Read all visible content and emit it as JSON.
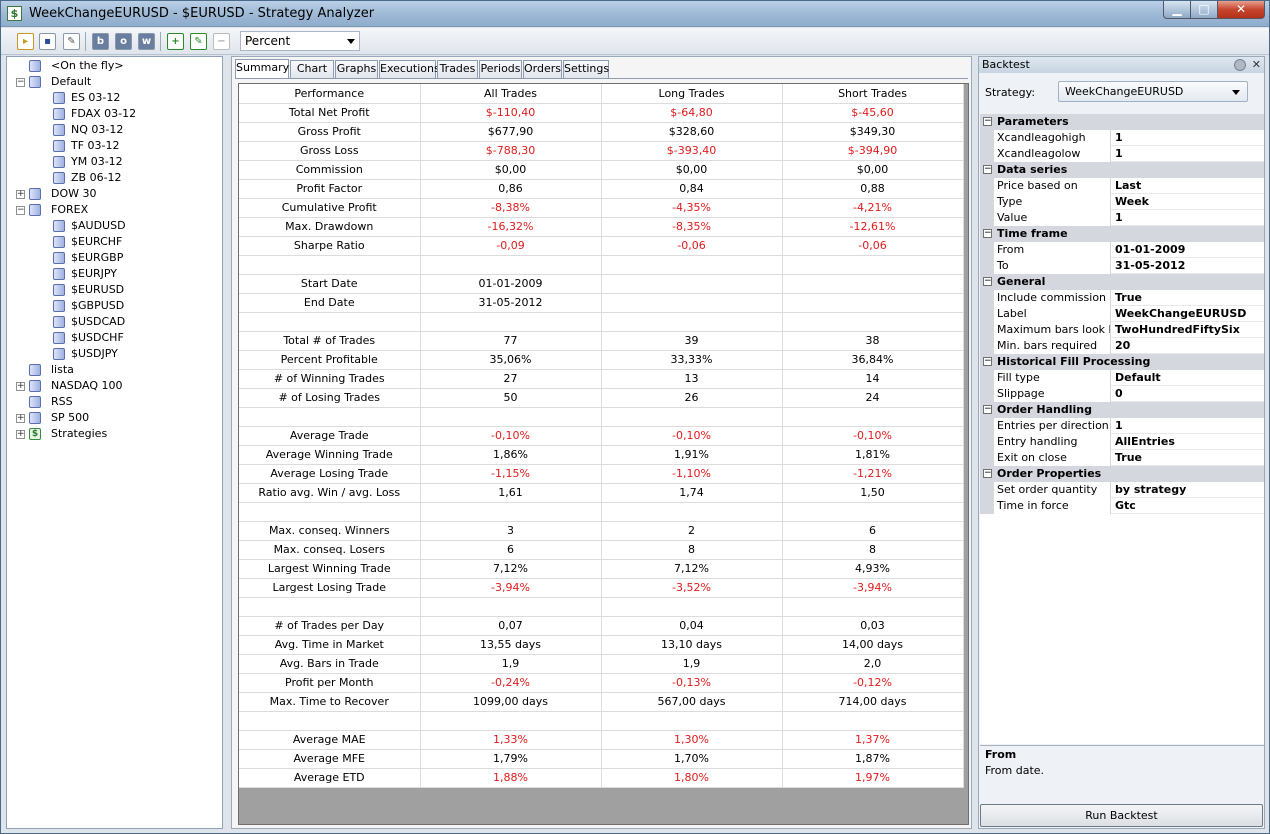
{
  "window": {
    "title": "WeekChangeEURUSD - $EURUSD - Strategy Analyzer"
  },
  "toolbar": {
    "buttons": [
      "open-icon",
      "save-icon",
      "edit-icon",
      "b-icon",
      "o-icon",
      "w-icon",
      "add-icon",
      "edit-strategy-icon",
      "remove-icon"
    ],
    "display_unit": "Percent"
  },
  "tree": {
    "items": [
      {
        "label": "<On the fly>",
        "level": 1,
        "expander": "",
        "icon": "db"
      },
      {
        "label": "Default",
        "level": 0,
        "expander": "−",
        "icon": "db"
      },
      {
        "label": "ES 03-12",
        "level": 2,
        "expander": "",
        "icon": "db"
      },
      {
        "label": "FDAX 03-12",
        "level": 2,
        "expander": "",
        "icon": "db"
      },
      {
        "label": "NQ 03-12",
        "level": 2,
        "expander": "",
        "icon": "db"
      },
      {
        "label": "TF 03-12",
        "level": 2,
        "expander": "",
        "icon": "db"
      },
      {
        "label": "YM 03-12",
        "level": 2,
        "expander": "",
        "icon": "db"
      },
      {
        "label": "ZB 06-12",
        "level": 2,
        "expander": "",
        "icon": "db"
      },
      {
        "label": "DOW 30",
        "level": 0,
        "expander": "+",
        "icon": "db"
      },
      {
        "label": "FOREX",
        "level": 0,
        "expander": "−",
        "icon": "db"
      },
      {
        "label": "$AUDUSD",
        "level": 2,
        "expander": "",
        "icon": "db"
      },
      {
        "label": "$EURCHF",
        "level": 2,
        "expander": "",
        "icon": "db"
      },
      {
        "label": "$EURGBP",
        "level": 2,
        "expander": "",
        "icon": "db"
      },
      {
        "label": "$EURJPY",
        "level": 2,
        "expander": "",
        "icon": "db"
      },
      {
        "label": "$EURUSD",
        "level": 2,
        "expander": "",
        "icon": "db"
      },
      {
        "label": "$GBPUSD",
        "level": 2,
        "expander": "",
        "icon": "db"
      },
      {
        "label": "$USDCAD",
        "level": 2,
        "expander": "",
        "icon": "db"
      },
      {
        "label": "$USDCHF",
        "level": 2,
        "expander": "",
        "icon": "db"
      },
      {
        "label": "$USDJPY",
        "level": 2,
        "expander": "",
        "icon": "db"
      },
      {
        "label": "lista",
        "level": 1,
        "expander": "",
        "icon": "db"
      },
      {
        "label": "NASDAQ 100",
        "level": 0,
        "expander": "+",
        "icon": "db"
      },
      {
        "label": "RSS",
        "level": 1,
        "expander": "",
        "icon": "db"
      },
      {
        "label": "SP 500",
        "level": 0,
        "expander": "+",
        "icon": "db"
      },
      {
        "label": "Strategies",
        "level": 0,
        "expander": "+",
        "icon": "strategy"
      }
    ]
  },
  "tabs": [
    "Summary",
    "Chart",
    "Graphs",
    "Executions",
    "Trades",
    "Periods",
    "Orders",
    "Settings"
  ],
  "active_tab": "Summary",
  "summary": {
    "headers": [
      "Performance",
      "All Trades",
      "Long Trades",
      "Short Trades"
    ],
    "rows": [
      {
        "label": "Total Net Profit",
        "values": [
          "$-110,40",
          "$-64,80",
          "$-45,60"
        ],
        "negative": true
      },
      {
        "label": "Gross Profit",
        "values": [
          "$677,90",
          "$328,60",
          "$349,30"
        ],
        "negative": false
      },
      {
        "label": "Gross Loss",
        "values": [
          "$-788,30",
          "$-393,40",
          "$-394,90"
        ],
        "negative": true
      },
      {
        "label": "Commission",
        "values": [
          "$0,00",
          "$0,00",
          "$0,00"
        ],
        "negative": false
      },
      {
        "label": "Profit Factor",
        "values": [
          "0,86",
          "0,84",
          "0,88"
        ],
        "negative": false
      },
      {
        "label": "Cumulative Profit",
        "values": [
          "-8,38%",
          "-4,35%",
          "-4,21%"
        ],
        "negative": true
      },
      {
        "label": "Max. Drawdown",
        "values": [
          "-16,32%",
          "-8,35%",
          "-12,61%"
        ],
        "negative": true
      },
      {
        "label": "Sharpe Ratio",
        "values": [
          "-0,09",
          "-0,06",
          "-0,06"
        ],
        "negative": true
      },
      {
        "label": "",
        "values": [
          "",
          "",
          ""
        ],
        "negative": false
      },
      {
        "label": "Start Date",
        "values": [
          "01-01-2009",
          "",
          ""
        ],
        "negative": false
      },
      {
        "label": "End Date",
        "values": [
          "31-05-2012",
          "",
          ""
        ],
        "negative": false
      },
      {
        "label": "",
        "values": [
          "",
          "",
          ""
        ],
        "negative": false
      },
      {
        "label": "Total # of Trades",
        "values": [
          "77",
          "39",
          "38"
        ],
        "negative": false
      },
      {
        "label": "Percent Profitable",
        "values": [
          "35,06%",
          "33,33%",
          "36,84%"
        ],
        "negative": false
      },
      {
        "label": "# of Winning Trades",
        "values": [
          "27",
          "13",
          "14"
        ],
        "negative": false
      },
      {
        "label": "# of Losing Trades",
        "values": [
          "50",
          "26",
          "24"
        ],
        "negative": false
      },
      {
        "label": "",
        "values": [
          "",
          "",
          ""
        ],
        "negative": false
      },
      {
        "label": "Average Trade",
        "values": [
          "-0,10%",
          "-0,10%",
          "-0,10%"
        ],
        "negative": true
      },
      {
        "label": "Average Winning Trade",
        "values": [
          "1,86%",
          "1,91%",
          "1,81%"
        ],
        "negative": false
      },
      {
        "label": "Average Losing Trade",
        "values": [
          "-1,15%",
          "-1,10%",
          "-1,21%"
        ],
        "negative": true
      },
      {
        "label": "Ratio avg. Win / avg. Loss",
        "values": [
          "1,61",
          "1,74",
          "1,50"
        ],
        "negative": false
      },
      {
        "label": "",
        "values": [
          "",
          "",
          ""
        ],
        "negative": false
      },
      {
        "label": "Max. conseq. Winners",
        "values": [
          "3",
          "2",
          "6"
        ],
        "negative": false
      },
      {
        "label": "Max. conseq. Losers",
        "values": [
          "6",
          "8",
          "8"
        ],
        "negative": false
      },
      {
        "label": "Largest Winning Trade",
        "values": [
          "7,12%",
          "7,12%",
          "4,93%"
        ],
        "negative": false
      },
      {
        "label": "Largest Losing Trade",
        "values": [
          "-3,94%",
          "-3,52%",
          "-3,94%"
        ],
        "negative": true
      },
      {
        "label": "",
        "values": [
          "",
          "",
          ""
        ],
        "negative": false
      },
      {
        "label": "# of Trades per Day",
        "values": [
          "0,07",
          "0,04",
          "0,03"
        ],
        "negative": false
      },
      {
        "label": "Avg. Time in Market",
        "values": [
          "13,55 days",
          "13,10 days",
          "14,00 days"
        ],
        "negative": false
      },
      {
        "label": "Avg. Bars in Trade",
        "values": [
          "1,9",
          "1,9",
          "2,0"
        ],
        "negative": false
      },
      {
        "label": "Profit per Month",
        "values": [
          "-0,24%",
          "-0,13%",
          "-0,12%"
        ],
        "negative": true
      },
      {
        "label": "Max. Time to Recover",
        "values": [
          "1099,00 days",
          "567,00 days",
          "714,00 days"
        ],
        "negative": false
      },
      {
        "label": "",
        "values": [
          "",
          "",
          ""
        ],
        "negative": false
      },
      {
        "label": "Average MAE",
        "values": [
          "1,33%",
          "1,30%",
          "1,37%"
        ],
        "negative": true
      },
      {
        "label": "Average MFE",
        "values": [
          "1,79%",
          "1,70%",
          "1,87%"
        ],
        "negative": false
      },
      {
        "label": "Average ETD",
        "values": [
          "1,88%",
          "1,80%",
          "1,97%"
        ],
        "negative": true
      }
    ]
  },
  "backtest": {
    "title": "Backtest",
    "strategy_label": "Strategy:",
    "strategy_value": "WeekChangeEURUSD",
    "categories": [
      {
        "name": "Parameters",
        "rows": [
          [
            "Xcandleagohigh",
            "1"
          ],
          [
            "Xcandleagolow",
            "1"
          ]
        ]
      },
      {
        "name": "Data series",
        "rows": [
          [
            "Price based on",
            "Last"
          ],
          [
            "Type",
            "Week"
          ],
          [
            "Value",
            "1"
          ]
        ]
      },
      {
        "name": "Time frame",
        "rows": [
          [
            "From",
            "01-01-2009"
          ],
          [
            "To",
            "31-05-2012"
          ]
        ]
      },
      {
        "name": "General",
        "rows": [
          [
            "Include commission",
            "True"
          ],
          [
            "Label",
            "WeekChangeEURUSD"
          ],
          [
            "Maximum bars look bac",
            "TwoHundredFiftySix"
          ],
          [
            "Min. bars required",
            "20"
          ]
        ]
      },
      {
        "name": "Historical Fill Processing",
        "rows": [
          [
            "Fill type",
            "Default"
          ],
          [
            "Slippage",
            "0"
          ]
        ]
      },
      {
        "name": "Order Handling",
        "rows": [
          [
            "Entries per direction",
            "1"
          ],
          [
            "Entry handling",
            "AllEntries"
          ],
          [
            "Exit on close",
            "True"
          ]
        ]
      },
      {
        "name": "Order Properties",
        "rows": [
          [
            "Set order quantity",
            "by strategy"
          ],
          [
            "Time in force",
            "Gtc"
          ]
        ]
      }
    ],
    "help_title": "From",
    "help_text": "From date.",
    "run_label": "Run Backtest"
  },
  "colors": {
    "negative": "#e21b1b",
    "titlebar": "#9fbad6"
  }
}
